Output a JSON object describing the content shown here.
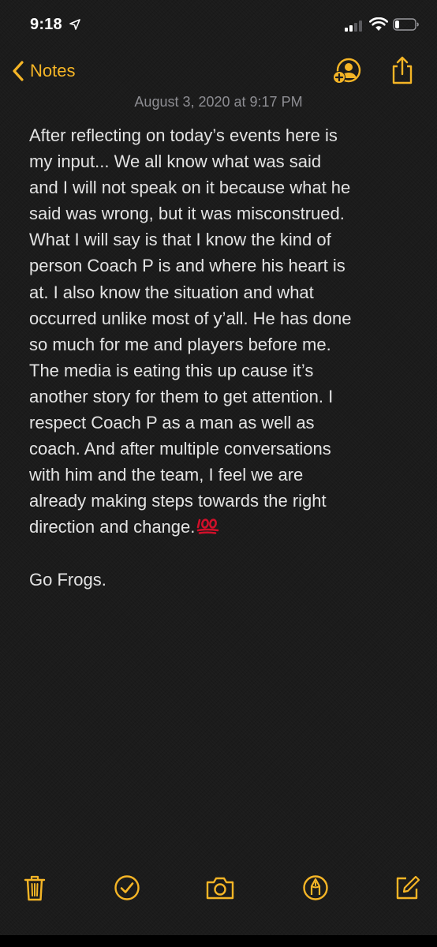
{
  "status_bar": {
    "time": "9:18"
  },
  "nav": {
    "back_label": "Notes"
  },
  "note": {
    "date": "August 3, 2020 at 9:17 PM",
    "lines": [
      "After reflecting on today’s events here is",
      "my input... We all know what was said",
      "and I will not speak on it because what he",
      "said was wrong, but it was misconstrued.",
      "What I will say is that I know the kind of",
      "person Coach P is and where his heart is",
      "at. I also know the situation and what",
      "occurred unlike most of y’all. He has done",
      "so much for me and players before me.",
      "The media is eating this up cause it’s",
      "another story for them to get attention. I",
      "respect Coach P as a man as well as",
      "coach. And after multiple conversations",
      "with him and the team, I feel we are",
      "already making steps towards the right",
      "direction and change."
    ],
    "closing": "Go Frogs."
  },
  "colors": {
    "accent": "#f5b526",
    "background": "#1c1c1e",
    "date_text": "#8e8e93",
    "body_text": "#e3e3e3",
    "emoji_red": "#d0102a"
  },
  "icons": {
    "emoji": "hundred-points-emoji",
    "toolbar": [
      "trash-icon",
      "checklist-icon",
      "camera-icon",
      "markup-icon",
      "compose-icon"
    ]
  }
}
